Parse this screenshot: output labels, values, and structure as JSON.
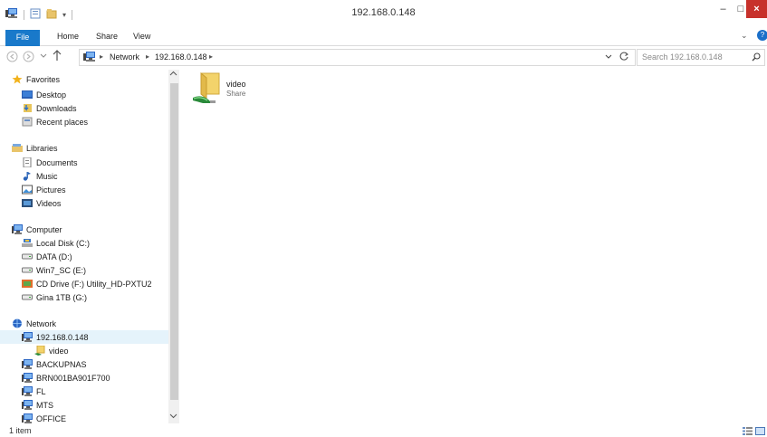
{
  "window": {
    "title": "192.168.0.148",
    "minimize_glyph": "–",
    "maximize_glyph": "□",
    "close_glyph": "×"
  },
  "ribbon": {
    "tabs": [
      "File",
      "Home",
      "Share",
      "View"
    ],
    "expand_glyph": "⌄",
    "help_glyph": "?"
  },
  "address": {
    "crumbs": [
      "Network",
      "192.168.0.148"
    ],
    "search_placeholder": "Search 192.168.0.148"
  },
  "nav_pane": {
    "items": [
      {
        "label": "Favorites",
        "icon": "star-icon"
      },
      {
        "label": "Desktop",
        "icon": "desktop-icon"
      },
      {
        "label": "Downloads",
        "icon": "downloads-icon"
      },
      {
        "label": "Recent places",
        "icon": "recent-places-icon"
      },
      {
        "label": "Libraries",
        "icon": "libraries-icon"
      },
      {
        "label": "Documents",
        "icon": "documents-icon"
      },
      {
        "label": "Music",
        "icon": "music-icon"
      },
      {
        "label": "Pictures",
        "icon": "pictures-icon"
      },
      {
        "label": "Videos",
        "icon": "videos-icon"
      },
      {
        "label": "Computer",
        "icon": "computer-icon"
      },
      {
        "label": "Local Disk (C:)",
        "icon": "local-disk-icon"
      },
      {
        "label": "DATA (D:)",
        "icon": "drive-icon"
      },
      {
        "label": "Win7_SC (E:)",
        "icon": "drive-icon"
      },
      {
        "label": "CD Drive (F:) Utility_HD-PXTU2",
        "icon": "cd-drive-icon"
      },
      {
        "label": "Gina 1TB (G:)",
        "icon": "drive-icon"
      },
      {
        "label": "Network",
        "icon": "network-icon"
      },
      {
        "label": "192.168.0.148",
        "icon": "network-computer-icon",
        "selected": true
      },
      {
        "label": "video",
        "icon": "shared-folder-icon"
      },
      {
        "label": "BACKUPNAS",
        "icon": "network-computer-icon"
      },
      {
        "label": "BRN001BA901F700",
        "icon": "network-computer-icon"
      },
      {
        "label": "FL",
        "icon": "network-computer-icon"
      },
      {
        "label": "MTS",
        "icon": "network-computer-icon"
      },
      {
        "label": "OFFICE",
        "icon": "network-computer-icon"
      }
    ]
  },
  "content": {
    "items": [
      {
        "name": "video",
        "type": "Share",
        "icon": "shared-folder-icon"
      }
    ]
  },
  "status": {
    "item_count": "1 item"
  },
  "colors": {
    "file_tab": "#1979ca",
    "close_button": "#c7312b",
    "selection": "#e5f3fb"
  }
}
